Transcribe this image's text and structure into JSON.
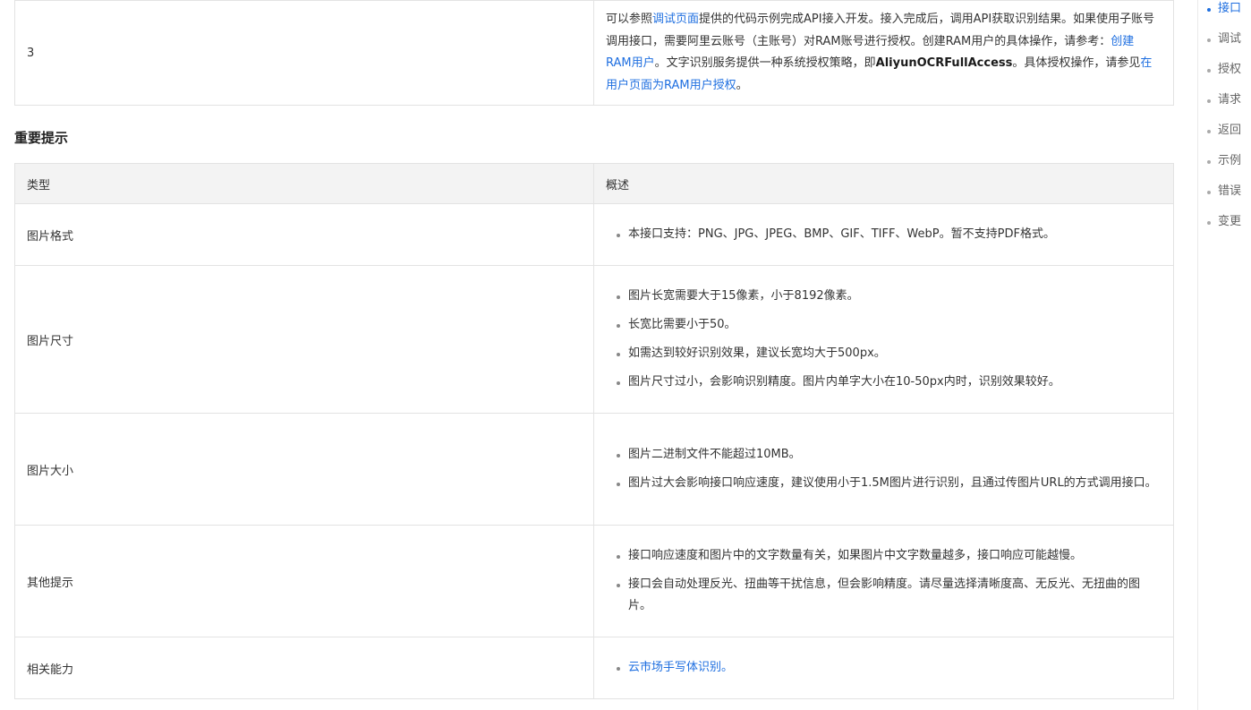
{
  "step_row": {
    "number": "3",
    "parts": [
      {
        "text": "可以参照",
        "type": "text"
      },
      {
        "text": "调试页面",
        "type": "link"
      },
      {
        "text": "提供的代码示例完成API接入开发。接入完成后，调用API获取识别结果。如果使用子账号调用接口，需要阿里云账号（主账号）对RAM账号进行授权。创建RAM用户的具体操作，请参考：",
        "type": "text"
      },
      {
        "text": "创建RAM用户",
        "type": "link"
      },
      {
        "text": "。文字识别服务提供一种系统授权策略，即",
        "type": "text"
      },
      {
        "text": "AliyunOCRFullAccess",
        "type": "bold"
      },
      {
        "text": "。具体授权操作，请参见",
        "type": "text"
      },
      {
        "text": "在用户页面为RAM用户授权",
        "type": "link"
      },
      {
        "text": "。",
        "type": "text"
      }
    ]
  },
  "section_heading": "重要提示",
  "tips_table": {
    "headers": [
      "类型",
      "概述"
    ],
    "rows": [
      {
        "type": "图片格式",
        "items": [
          "本接口支持：PNG、JPG、JPEG、BMP、GIF、TIFF、WebP。暂不支持PDF格式。"
        ]
      },
      {
        "type": "图片尺寸",
        "items": [
          "图片长宽需要大于15像素，小于8192像素。",
          "长宽比需要小于50。",
          "如需达到较好识别效果，建议长宽均大于500px。",
          "图片尺寸过小，会影响识别精度。图片内单字大小在10-50px内时，识别效果较好。"
        ]
      },
      {
        "type": "图片大小",
        "items": [
          "图片二进制文件不能超过10MB。",
          "图片过大会影响接口响应速度，建议使用小于1.5M图片进行识别，且通过传图片URL的方式调用接口。"
        ]
      },
      {
        "type": "其他提示",
        "items": [
          "接口响应速度和图片中的文字数量有关，如果图片中文字数量越多，接口响应可能越慢。",
          "接口会自动处理反光、扭曲等干扰信息，但会影响精度。请尽量选择清晰度高、无反光、无扭曲的图片。"
        ]
      },
      {
        "type": "相关能力",
        "link": "云市场手写体识别",
        "suffix": "。"
      }
    ]
  },
  "toc": {
    "items": [
      "接口",
      "调试",
      "授权",
      "请求",
      "返回",
      "示例",
      "错误",
      "变更"
    ],
    "active_index": 0
  },
  "colors": {
    "link": "#1f6fe0",
    "header_bg": "#f3f3f3",
    "border": "#e3e3e3"
  }
}
